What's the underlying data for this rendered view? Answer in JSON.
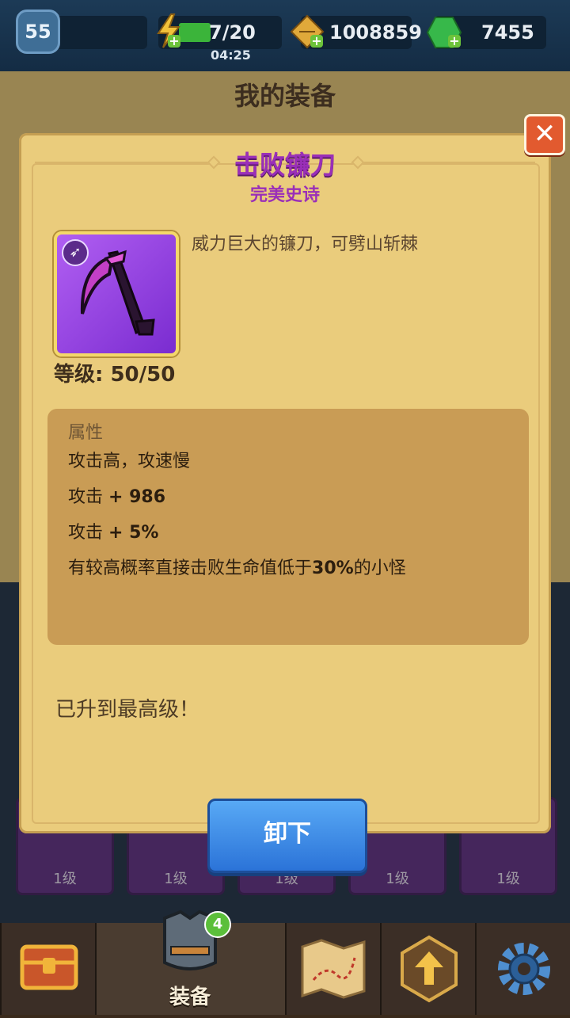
{
  "hud": {
    "player_level": "55",
    "energy": "7/20",
    "energy_timer": "04:25",
    "gold": "1008859",
    "gems": "7455"
  },
  "page": {
    "title": "我的装备"
  },
  "background_cells": [
    {
      "level": "1级"
    },
    {
      "level": "1级"
    },
    {
      "level": "1级"
    },
    {
      "level": "1级"
    },
    {
      "level": "1级"
    }
  ],
  "dialog": {
    "item_name": "击败镰刀",
    "item_quality": "完美史诗",
    "description": "威力巨大的镰刀，可劈山斩棘",
    "level_label": "等级: 50/50",
    "attributes_heading": "属性",
    "attributes": {
      "line1": "攻击高，攻速慢",
      "line2_prefix": "攻击 ",
      "line2_value": "+ 986",
      "line3_prefix": "攻击 ",
      "line3_value": "+ 5%",
      "line4_prefix": "有较高概率直接击败生命值低于",
      "line4_value": "30%",
      "line4_suffix": "的小怪"
    },
    "max_level_text": "已升到最高级！",
    "unequip_button": "卸下",
    "close_icon": "close-icon"
  },
  "nav": {
    "items": [
      {
        "icon": "treasure-chest-icon"
      },
      {
        "icon": "armor-icon",
        "label": "装备",
        "badge": "4",
        "active": true
      },
      {
        "icon": "map-icon"
      },
      {
        "icon": "upgrade-arrow-icon"
      },
      {
        "icon": "gear-icon"
      }
    ]
  },
  "colors": {
    "epic_purple": "#9a2fb8",
    "panel": "#eacc7c",
    "button_blue": "#2b73d8"
  }
}
